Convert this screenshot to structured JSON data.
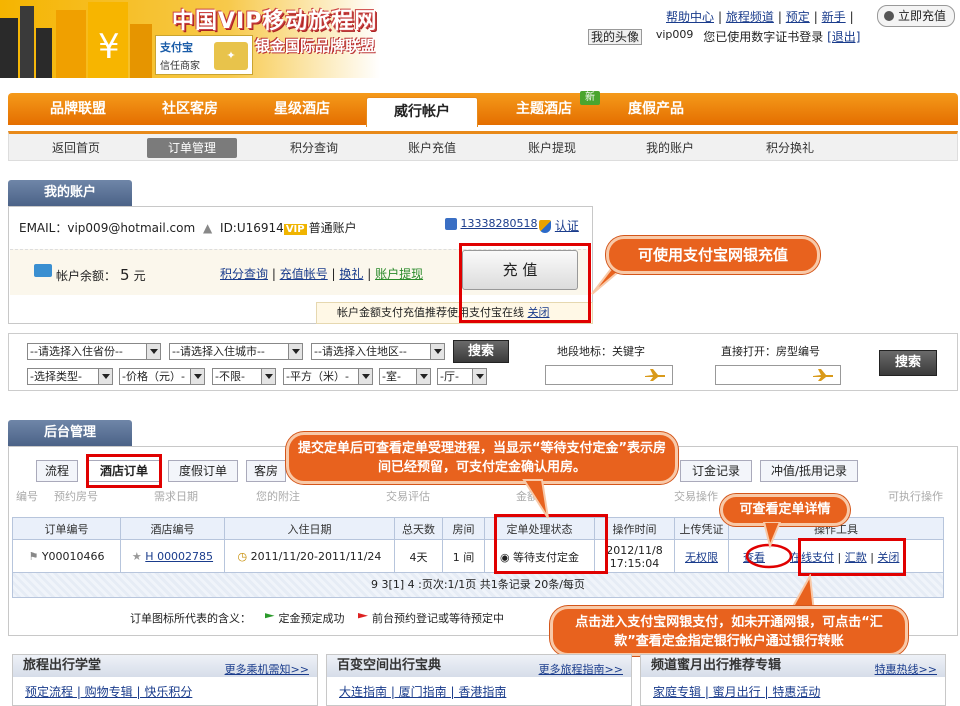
{
  "header": {
    "site_title": "中国VIP移动旅程网",
    "site_subtitle": "银金国际品牌联盟",
    "alipay_name": "支付宝",
    "alipay_tag": "信任商家",
    "links": [
      "帮助中心",
      "旅程频道",
      "预定",
      "新手"
    ],
    "charge_button": "立即充值",
    "avatar_label": "我的头像",
    "username": "vip009",
    "cert_text": "您已使用数字证书登录",
    "logout": "[退出]"
  },
  "nav": {
    "items": [
      "品牌联盟",
      "社区客房",
      "星级酒店",
      "威行帐户",
      "主题酒店",
      "度假产品"
    ],
    "new_badge": "新",
    "sub_items": [
      "返回首页",
      "订单管理",
      "积分查询",
      "账户充值",
      "账户提现",
      "我的账户",
      "积分换礼"
    ]
  },
  "account": {
    "tab": "我的账户",
    "email_label": "EMAIL：vip009@hotmail.com",
    "id_label": "ID:U16914",
    "vip": "VIP",
    "account_type": "普通账户",
    "phone": "13338280518",
    "auth": "认证",
    "balance_label": "帐户余额：",
    "balance_value": "5",
    "balance_unit": "元",
    "links": [
      "积分查询",
      "充值帐号",
      "换礼",
      "账户提现"
    ],
    "charge_button": "充 值",
    "tip": "帐户金额支付充值推荐使用支付宝在线",
    "tip_close": "关闭"
  },
  "callouts": {
    "c1": "可使用支付宝网银充值",
    "c2": "提交定单后可查看定单受理进程，当显示“等待支付定金”表示房间已经预留，可支付定金确认用房。",
    "c3": "可查看定单详情",
    "c4": "点击进入支付宝网银支付，如未开通网银，可点击“汇款”查看定金指定银行帐户通过银行转账"
  },
  "search": {
    "selects_row1": [
      "--请选择入住省份--",
      "--请选择入住城市--",
      "--请选择入住地区--"
    ],
    "selects_row2": [
      "-选择类型-",
      "-价格（元）-",
      "-不限-",
      "-平方（米）-",
      "-室-",
      "-厅-"
    ],
    "search_button": "搜索",
    "landmark_label": "地段地标：关键字",
    "direct_label": "直接打开：房型编号",
    "search_button2": "搜索"
  },
  "backend": {
    "tab": "后台管理",
    "tabs": [
      "流程",
      "酒店订单",
      "度假订单",
      "客房",
      "订金记录",
      "冲值/抵用记录"
    ],
    "header_hints": [
      "编号",
      "预约房号",
      "需求日期",
      "您的附注",
      "交易评估",
      "金额",
      "交易操作",
      "可执行操作"
    ],
    "columns": [
      "订单编号",
      "酒店编号",
      "入住日期",
      "总天数",
      "房间",
      "定单处理状态",
      "操作时间",
      "上传凭证",
      "操作工具"
    ],
    "row": {
      "order_no": "Y00010466",
      "hotel_no": "H 00002785",
      "dates": "2011/11/20-2011/11/24",
      "days": "4天",
      "rooms": "1 间",
      "status": "等待支付定金",
      "time_date": "2012/11/8",
      "time_clock": "17:15:04",
      "upload": "无权限",
      "view": "查看",
      "pay": "在线支付",
      "remit": "汇款",
      "close": "关闭"
    },
    "pager": "9 3[1] 4 :页次:1/1页 共1条记录 20条/每页",
    "legend_label": "订单图标所代表的含义：",
    "legend_items": [
      "定金预定成功",
      "前台预约登记或等待预定中"
    ]
  },
  "bottom": [
    {
      "title": "旅程出行学堂",
      "more": "更多乘机需知>>",
      "links": "预定流程 | 购物专辑 | 快乐积分"
    },
    {
      "title": "百变空间出行宝典",
      "more": "更多旅程指南>>",
      "links": "大连指南 | 厦门指南 | 香港指南"
    },
    {
      "title": "频道蜜月出行推荐专辑",
      "more": "特惠热线>>",
      "links": "家庭专辑 | 蜜月出行 | 特惠活动"
    }
  ],
  "colors": {
    "accent": "#e8621e",
    "nav": "#f07f0a",
    "highlight": "#e00000",
    "link": "#1a3c8c"
  }
}
